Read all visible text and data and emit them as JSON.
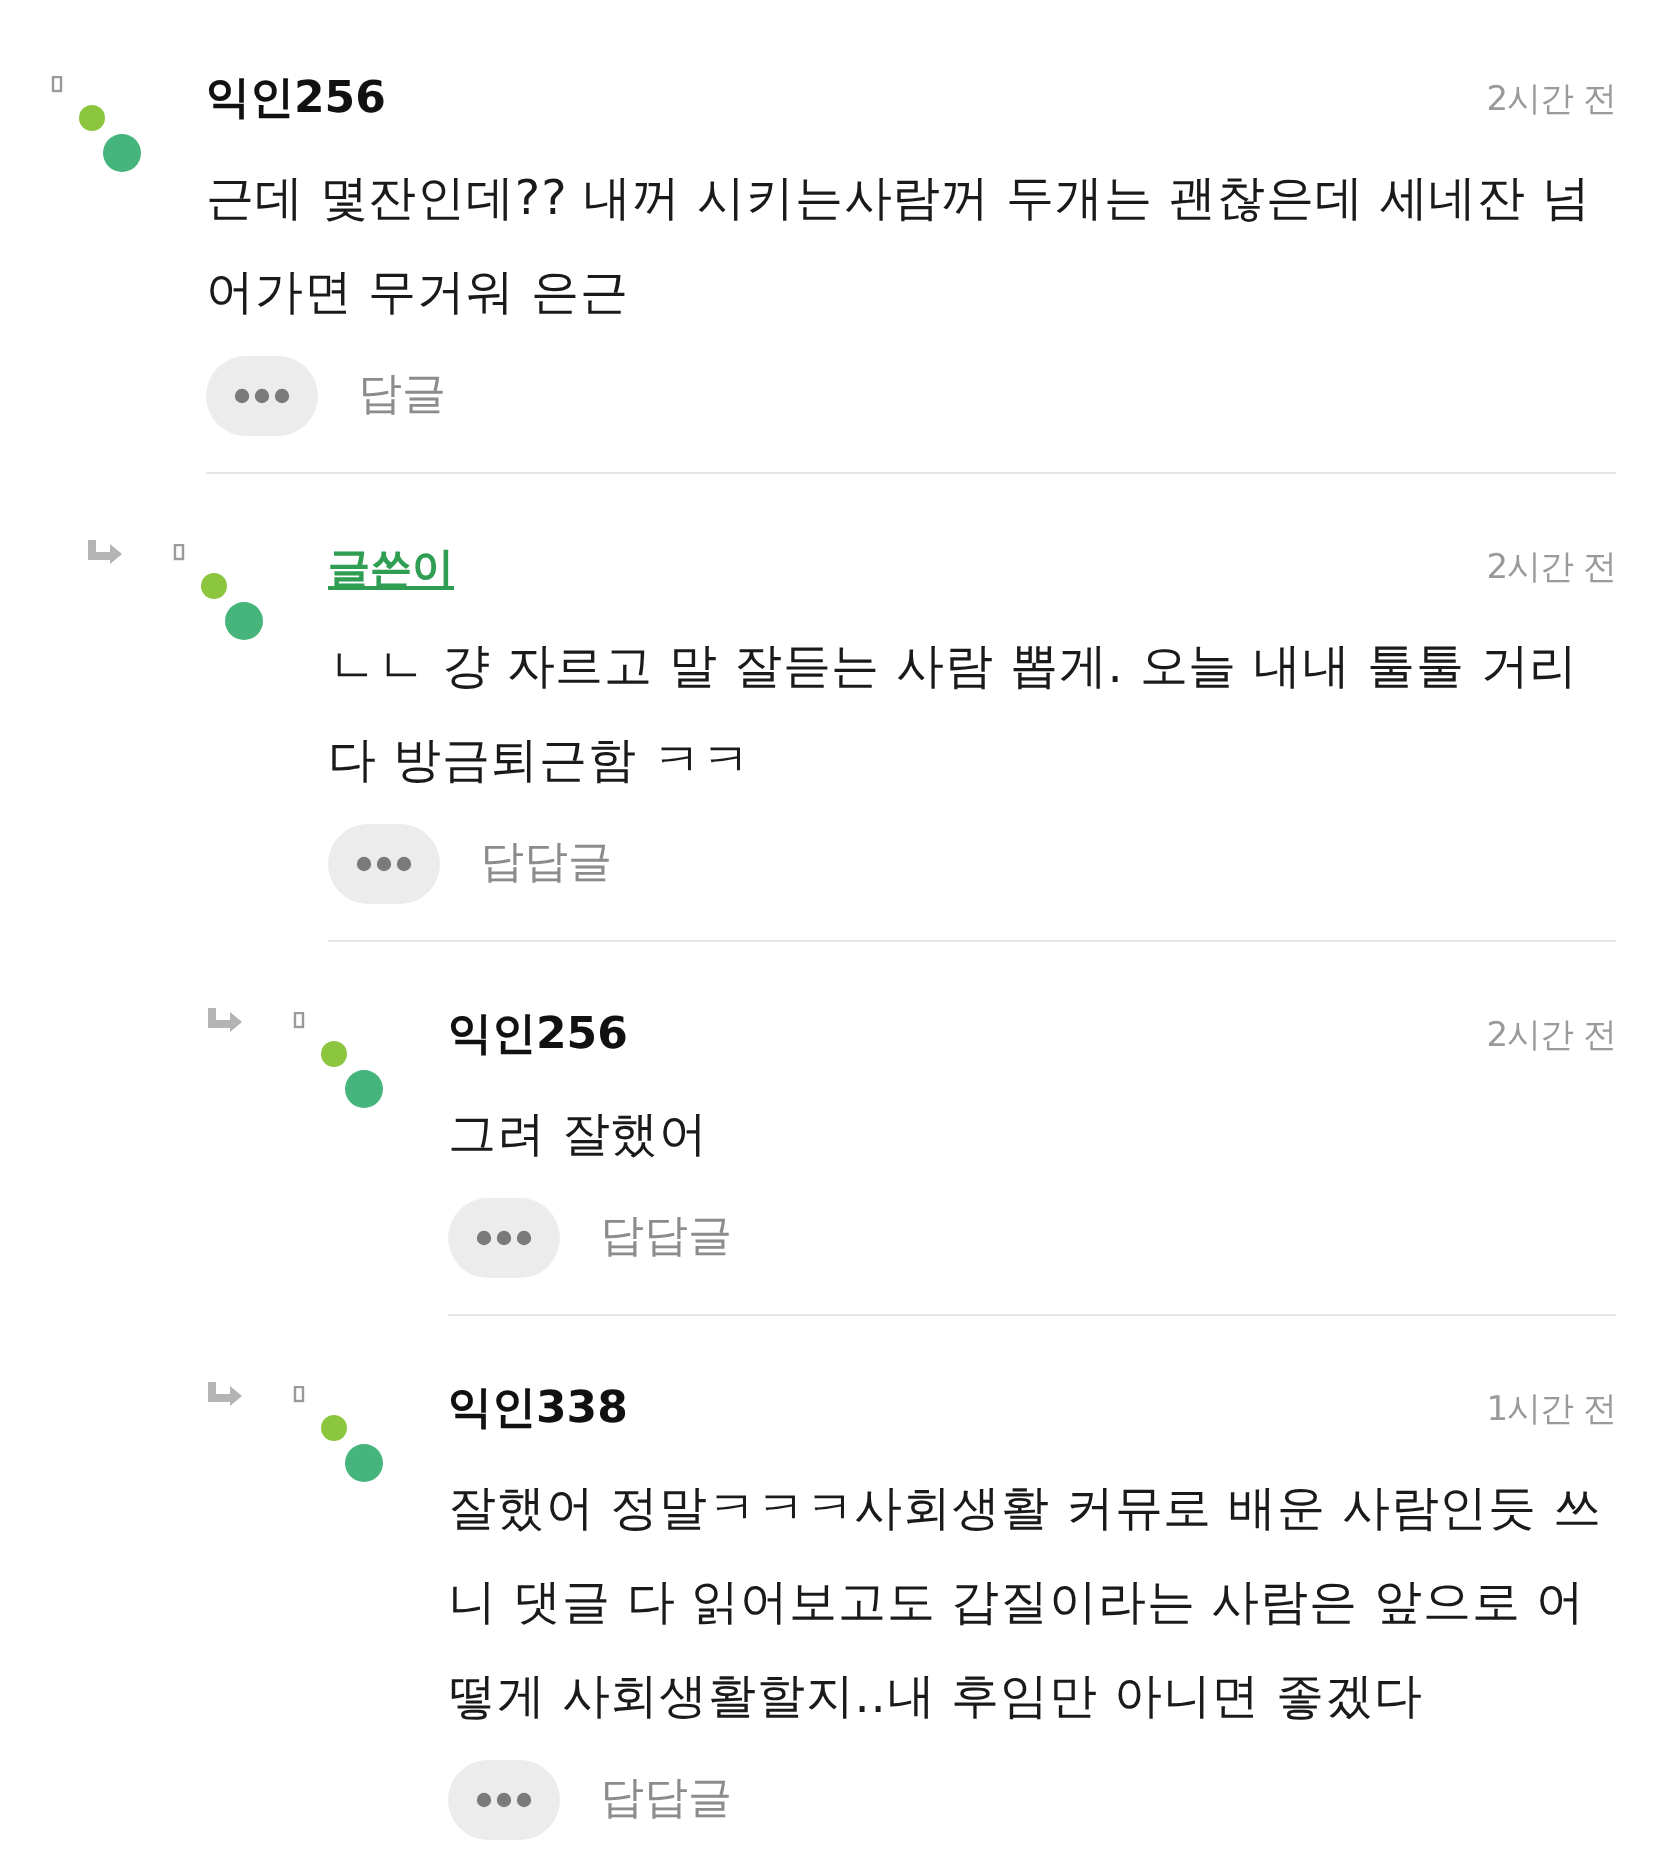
{
  "comments": [
    {
      "name": "익인256",
      "author": false,
      "time": "2시간 전",
      "body": "근데 몇잔인데?? 내꺼 시키는사람꺼 두개는 괜찮은데 세네잔 넘어가면 무거워 은근",
      "reply_label": "답글",
      "children": [
        {
          "name": "글쓴이",
          "author": true,
          "time": "2시간 전",
          "body": "ㄴㄴ 걍 자르고 말 잘듣는 사람 뽑게. 오늘 내내 툴툴 거리다 방금퇴근함 ㅋㅋ",
          "reply_label": "답답글",
          "children": [
            {
              "name": "익인256",
              "author": false,
              "time": "2시간 전",
              "body": "그려 잘했어",
              "reply_label": "답답글"
            },
            {
              "name": "익인338",
              "author": false,
              "time": "1시간 전",
              "body": "잘했어 정말ㅋㅋㅋ사회생활 커뮤로 배운 사람인듯 쓰니 댓글 다 읽어보고도 갑질이라는 사람은 앞으로 어떻게 사회생활할지..내 후임만 아니면 좋겠다",
              "reply_label": "답답글"
            }
          ]
        }
      ]
    }
  ]
}
